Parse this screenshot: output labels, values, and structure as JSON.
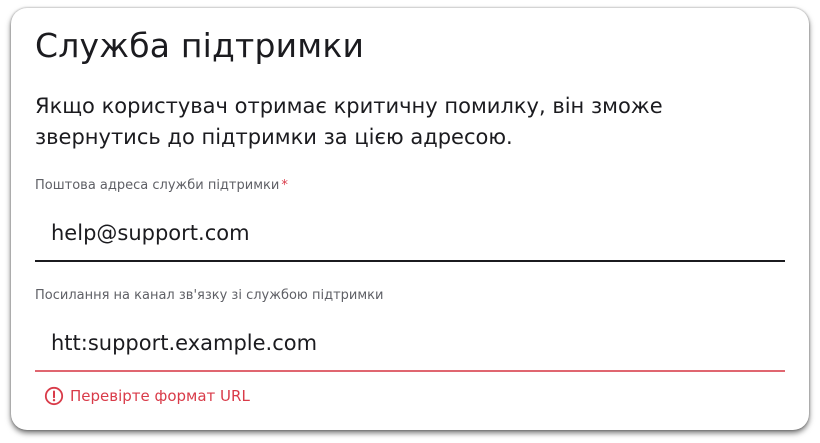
{
  "card": {
    "title": "Служба підтримки",
    "description": "Якщо користувач отримає критичну помилку, він зможе звернутись до підтримки за цією адресою."
  },
  "email_field": {
    "label": "Поштова адреса служби підтримки",
    "required_mark": "*",
    "value": "help@support.com"
  },
  "channel_field": {
    "label": "Посилання на канал зв'язку зі службою підтримки",
    "value": "htt:support.example.com",
    "error": {
      "icon": "error-circle-icon",
      "message": "Перевірте формат URL"
    }
  },
  "colors": {
    "text": "#1b1b1f",
    "label": "#5f6066",
    "error": "#d93b49",
    "error_line": "#e06670"
  }
}
